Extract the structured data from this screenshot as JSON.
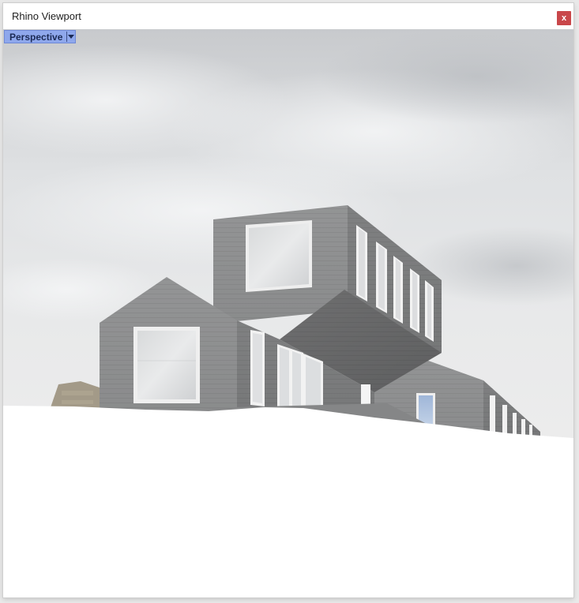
{
  "window": {
    "title": "Rhino Viewport",
    "close_label": "x"
  },
  "viewport": {
    "view_name": "Perspective",
    "view_menu_icon": "chevron-down-icon"
  },
  "colors": {
    "view_tab_background": "#8fa8ec",
    "close_button": "#c9474a",
    "concrete": "#8a8b8c",
    "sky": "#d5d7d9",
    "ground": "#ffffff"
  }
}
